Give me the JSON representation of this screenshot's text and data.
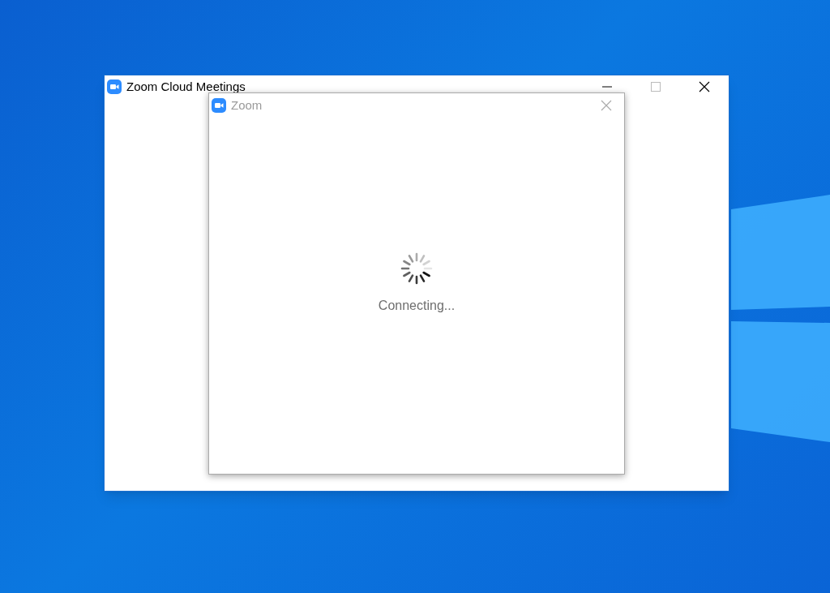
{
  "main_window": {
    "title": "Zoom Cloud Meetings"
  },
  "dialog": {
    "title": "Zoom",
    "status": "Connecting..."
  }
}
